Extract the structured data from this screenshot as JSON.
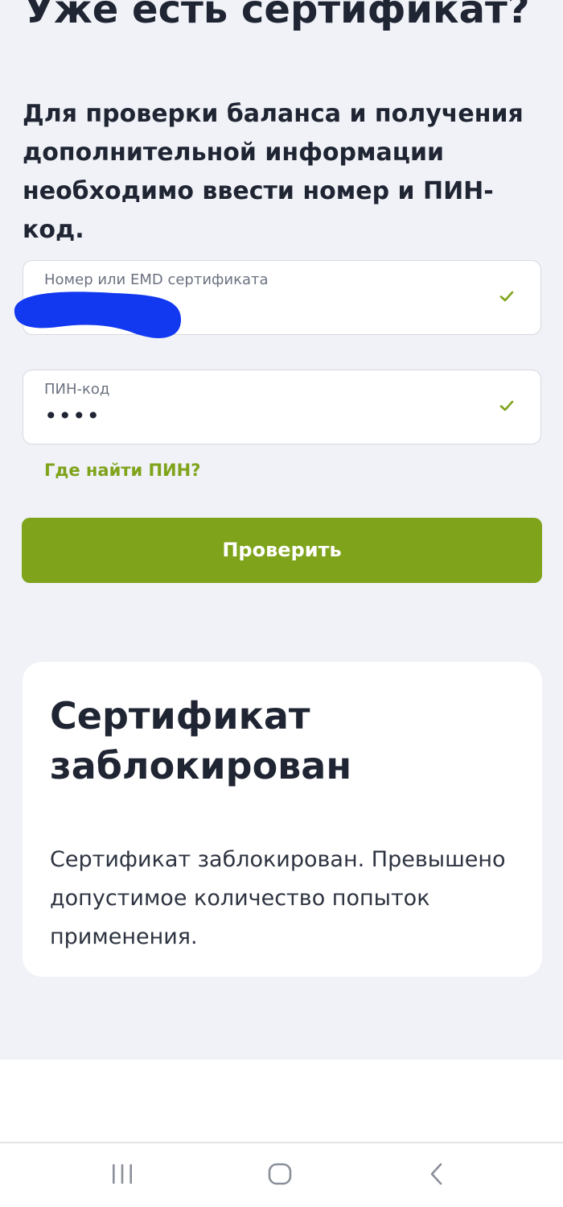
{
  "header": {
    "title": "Уже есть сертификат?"
  },
  "intro": {
    "text": "Для проверки баланса и получения дополнительной информации необходимо ввести номер и ПИН-код."
  },
  "form": {
    "number_field": {
      "label": "Номер или EMD сертификата",
      "value": ""
    },
    "pin_field": {
      "label": "ПИН-код",
      "value": "••••"
    },
    "pin_help_link": "Где найти ПИН?",
    "submit_label": "Проверить"
  },
  "result_card": {
    "title": "Сертификат заблокирован",
    "message": "Сертификат заблокирован. Превышено допустимое количество попыток применения."
  },
  "colors": {
    "accent": "#7fa31b",
    "background": "#f0f2f7",
    "redaction": "#1238f0"
  },
  "icons": {
    "field_valid": "check-icon",
    "nav_recents": "recents-icon",
    "nav_home": "home-icon",
    "nav_back": "back-icon"
  }
}
